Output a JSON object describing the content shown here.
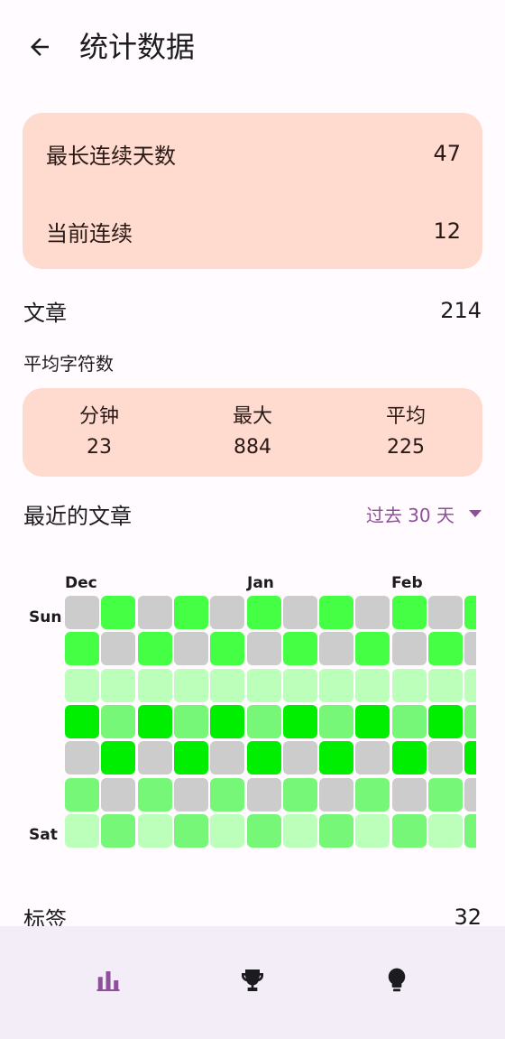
{
  "header": {
    "title": "统计数据",
    "back_icon": "arrow-left-icon"
  },
  "streaks": {
    "longest_label": "最长连续天数",
    "longest_value": "47",
    "current_label": "当前连续",
    "current_value": "12"
  },
  "articles": {
    "label": "文章",
    "value": "214"
  },
  "avg_chars": {
    "label": "平均字符数",
    "stats": [
      {
        "label": "分钟",
        "value": "23"
      },
      {
        "label": "最大",
        "value": "884"
      },
      {
        "label": "平均",
        "value": "225"
      }
    ]
  },
  "recent": {
    "label": "最近的文章",
    "range": "过去 30 天"
  },
  "heatmap": {
    "months": [
      "Dec",
      "Jan",
      "Feb"
    ],
    "day_labels": [
      "Sun",
      "Sat"
    ],
    "colors": {
      "empty": "#cccccc",
      "l1": "#bbffbb",
      "l2": "#77f777",
      "l3": "#44ff44",
      "l4": "#00ee00"
    },
    "rows": [
      [
        "empty",
        "l3",
        "empty",
        "l3",
        "empty",
        "l3",
        "empty",
        "l3",
        "empty",
        "l3",
        "empty",
        "l3"
      ],
      [
        "l3",
        "empty",
        "l3",
        "empty",
        "l3",
        "empty",
        "l3",
        "empty",
        "l3",
        "empty",
        "l3",
        "empty"
      ],
      [
        "l1",
        "l1",
        "l1",
        "l1",
        "l1",
        "l1",
        "l1",
        "l1",
        "l1",
        "l1",
        "l1",
        "l1"
      ],
      [
        "l4",
        "l2",
        "l4",
        "l2",
        "l4",
        "l2",
        "l4",
        "l2",
        "l4",
        "l2",
        "l4",
        "l2"
      ],
      [
        "empty",
        "l4",
        "empty",
        "l4",
        "empty",
        "l4",
        "empty",
        "l4",
        "empty",
        "l4",
        "empty",
        "l4"
      ],
      [
        "l2",
        "empty",
        "l2",
        "empty",
        "l2",
        "empty",
        "l2",
        "empty",
        "l2",
        "empty",
        "l2",
        "empty"
      ],
      [
        "l1",
        "l2",
        "l1",
        "l2",
        "l1",
        "l2",
        "l1",
        "l2",
        "l1",
        "l2",
        "l1",
        "l2"
      ]
    ]
  },
  "tags": {
    "label": "标签",
    "value": "32"
  },
  "nav": {
    "items": [
      {
        "icon": "bar-chart-icon",
        "active": true,
        "color": "#8e4f9b"
      },
      {
        "icon": "trophy-icon",
        "active": false,
        "color": "#1c1b1f"
      },
      {
        "icon": "lightbulb-icon",
        "active": false,
        "color": "#1c1b1f"
      }
    ]
  }
}
